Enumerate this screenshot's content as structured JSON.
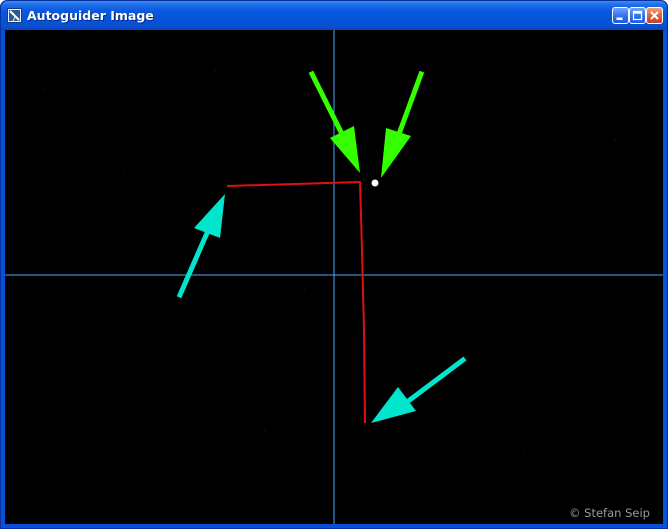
{
  "window": {
    "title": "Autoguider Image",
    "icons": {
      "app": "telescope-app-icon",
      "minimize": "minimize-icon",
      "maximize": "maximize-icon",
      "close": "close-icon"
    }
  },
  "image": {
    "credit": "© Stefan Seip"
  },
  "colors": {
    "titlebar": "#0a58df",
    "crosshair": "#4aa8ff",
    "trail": "#e01010",
    "green_arrow": "#33ff00",
    "cyan_arrow": "#00e6cc",
    "star": "#ffffff",
    "background": "#000000"
  }
}
